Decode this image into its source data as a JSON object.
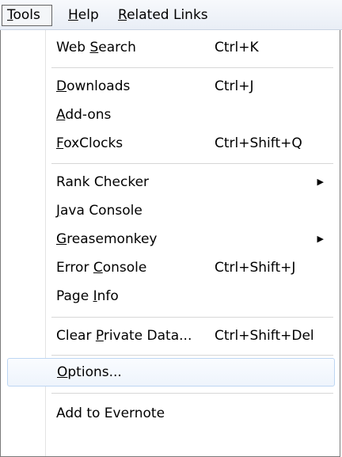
{
  "menubar": {
    "tools": {
      "pre": "",
      "accel": "T",
      "post": "ools"
    },
    "help": {
      "pre": "",
      "accel": "H",
      "post": "elp"
    },
    "related_links": {
      "pre": "",
      "accel": "R",
      "post": "elated Links"
    }
  },
  "menu": {
    "web_search": {
      "pre": "Web ",
      "accel": "S",
      "post": "earch",
      "shortcut": "Ctrl+K"
    },
    "downloads": {
      "pre": "",
      "accel": "D",
      "post": "ownloads",
      "shortcut": "Ctrl+J"
    },
    "addons": {
      "pre": "",
      "accel": "A",
      "post": "dd-ons"
    },
    "foxclocks": {
      "pre": "",
      "accel": "F",
      "post": "oxClocks",
      "shortcut": "Ctrl+Shift+Q"
    },
    "rank_checker": {
      "label": "Rank Checker",
      "arrow": "▶"
    },
    "java_console": {
      "pre": "",
      "accel": "J",
      "post": "ava Console"
    },
    "greasemonkey": {
      "pre": "",
      "accel": "G",
      "post": "reasemonkey",
      "arrow": "▶"
    },
    "error_console": {
      "pre": "Error ",
      "accel": "C",
      "post": "onsole",
      "shortcut": "Ctrl+Shift+J"
    },
    "page_info": {
      "pre": "Page ",
      "accel": "I",
      "post": "nfo"
    },
    "clear_private_data": {
      "pre": "Clear ",
      "accel": "P",
      "post": "rivate Data...",
      "shortcut": "Ctrl+Shift+Del"
    },
    "options": {
      "pre": "",
      "accel": "O",
      "post": "ptions..."
    },
    "add_to_evernote": {
      "label": "Add to Evernote"
    }
  }
}
